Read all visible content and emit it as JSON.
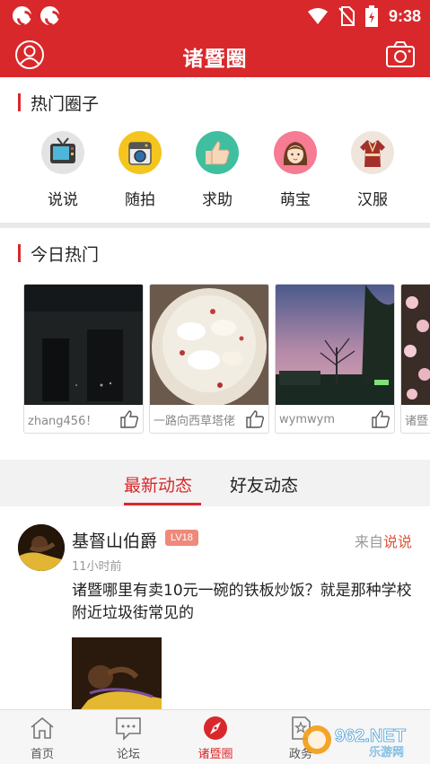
{
  "status_bar": {
    "time": "9:38"
  },
  "header": {
    "title": "诸暨圈"
  },
  "hot_circles": {
    "title": "热门圈子",
    "items": [
      {
        "label": "说说",
        "icon": "tv-icon"
      },
      {
        "label": "随拍",
        "icon": "camera-icon"
      },
      {
        "label": "求助",
        "icon": "thumbs-up-icon"
      },
      {
        "label": "萌宝",
        "icon": "girl-icon"
      },
      {
        "label": "汉服",
        "icon": "hanfu-icon"
      }
    ]
  },
  "today_hot": {
    "title": "今日热门",
    "cards": [
      {
        "author": "zhang456！"
      },
      {
        "author": "一路向西草塔佬"
      },
      {
        "author": "wymwym"
      },
      {
        "author": "诸暨"
      }
    ]
  },
  "tabs": {
    "latest": "最新动态",
    "friends": "好友动态"
  },
  "post": {
    "username": "基督山伯爵",
    "level": "LV18",
    "from_prefix": "来自",
    "from_source": "说说",
    "time": "11小时前",
    "text": "诸暨哪里有卖10元一碗的铁板炒饭？就是那种学校附近垃圾街常见的"
  },
  "bottom_nav": {
    "items": [
      {
        "label": "首页"
      },
      {
        "label": "论坛"
      },
      {
        "label": "诸暨圈"
      },
      {
        "label": "政务"
      }
    ]
  },
  "watermark": {
    "text": "962.NET",
    "sub": "乐游网"
  },
  "colors": {
    "brand": "#d9282b",
    "level_badge": "#ef8a7a",
    "source_link": "#e0573b"
  }
}
